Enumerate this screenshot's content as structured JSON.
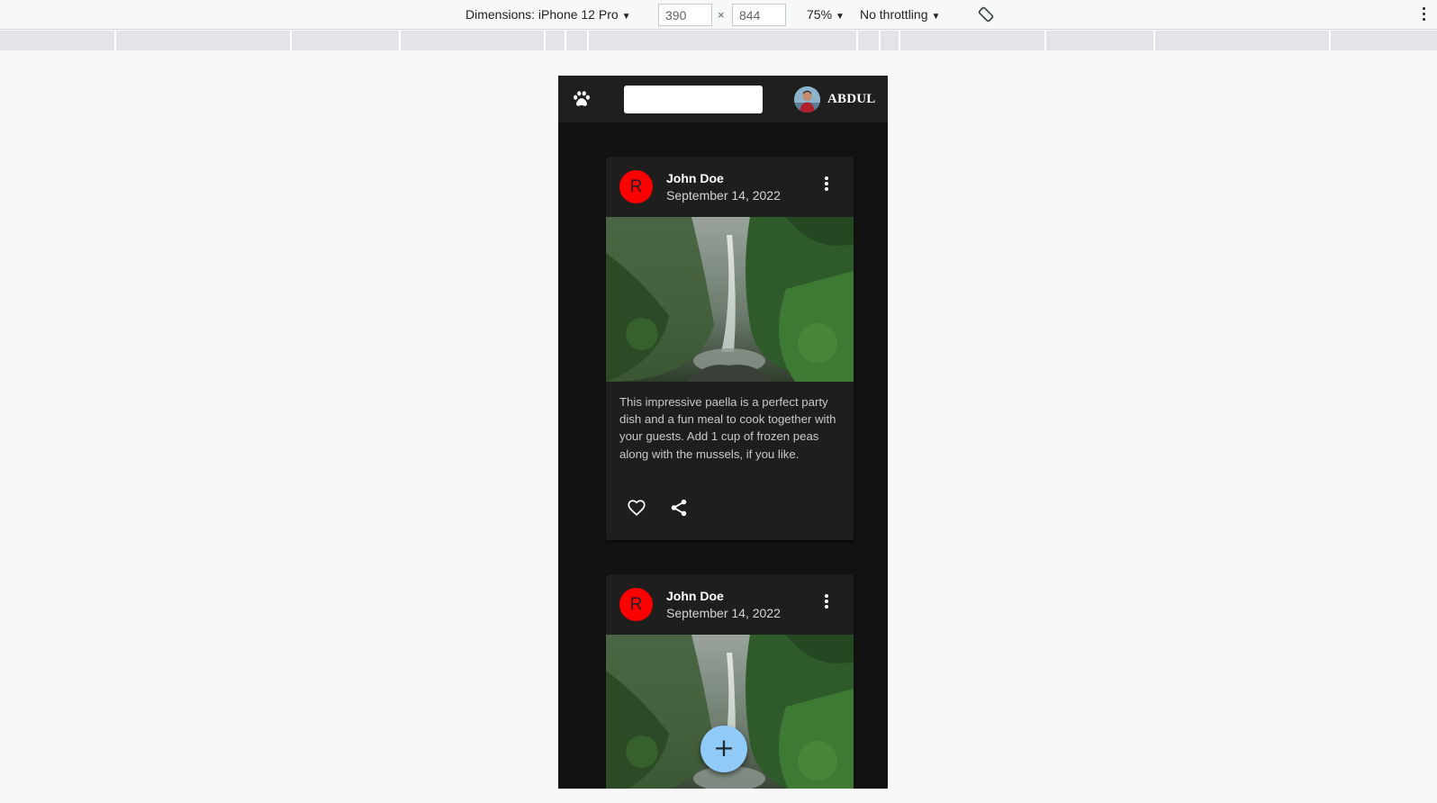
{
  "devtools": {
    "device_label": "Dimensions: iPhone 12 Pro",
    "width_value": "390",
    "height_value": "844",
    "separator": "×",
    "zoom": "75%",
    "throttling": "No throttling",
    "icons": [
      "chevron-down-icon",
      "rotate-icon",
      "more-vert-icon"
    ]
  },
  "app": {
    "appbar": {
      "logo_icon": "paw-icon",
      "search_value": "",
      "username": "ABDUL"
    },
    "posts": [
      {
        "avatar_letter": "R",
        "author": "John Doe",
        "date": "September 14, 2022",
        "body": "This impressive paella is a perfect party dish and a fun meal to cook together with your guests. Add 1 cup of frozen peas along with the mussels, if you like.",
        "actions": [
          "favorite-icon",
          "share-icon"
        ]
      },
      {
        "avatar_letter": "R",
        "author": "John Doe",
        "date": "September 14, 2022"
      }
    ],
    "fab_label": "+"
  },
  "colors": {
    "app_background": "#121212",
    "card_background": "#1e1e1e",
    "avatar_red": "#ff0000",
    "fab_blue": "#90caf9"
  }
}
